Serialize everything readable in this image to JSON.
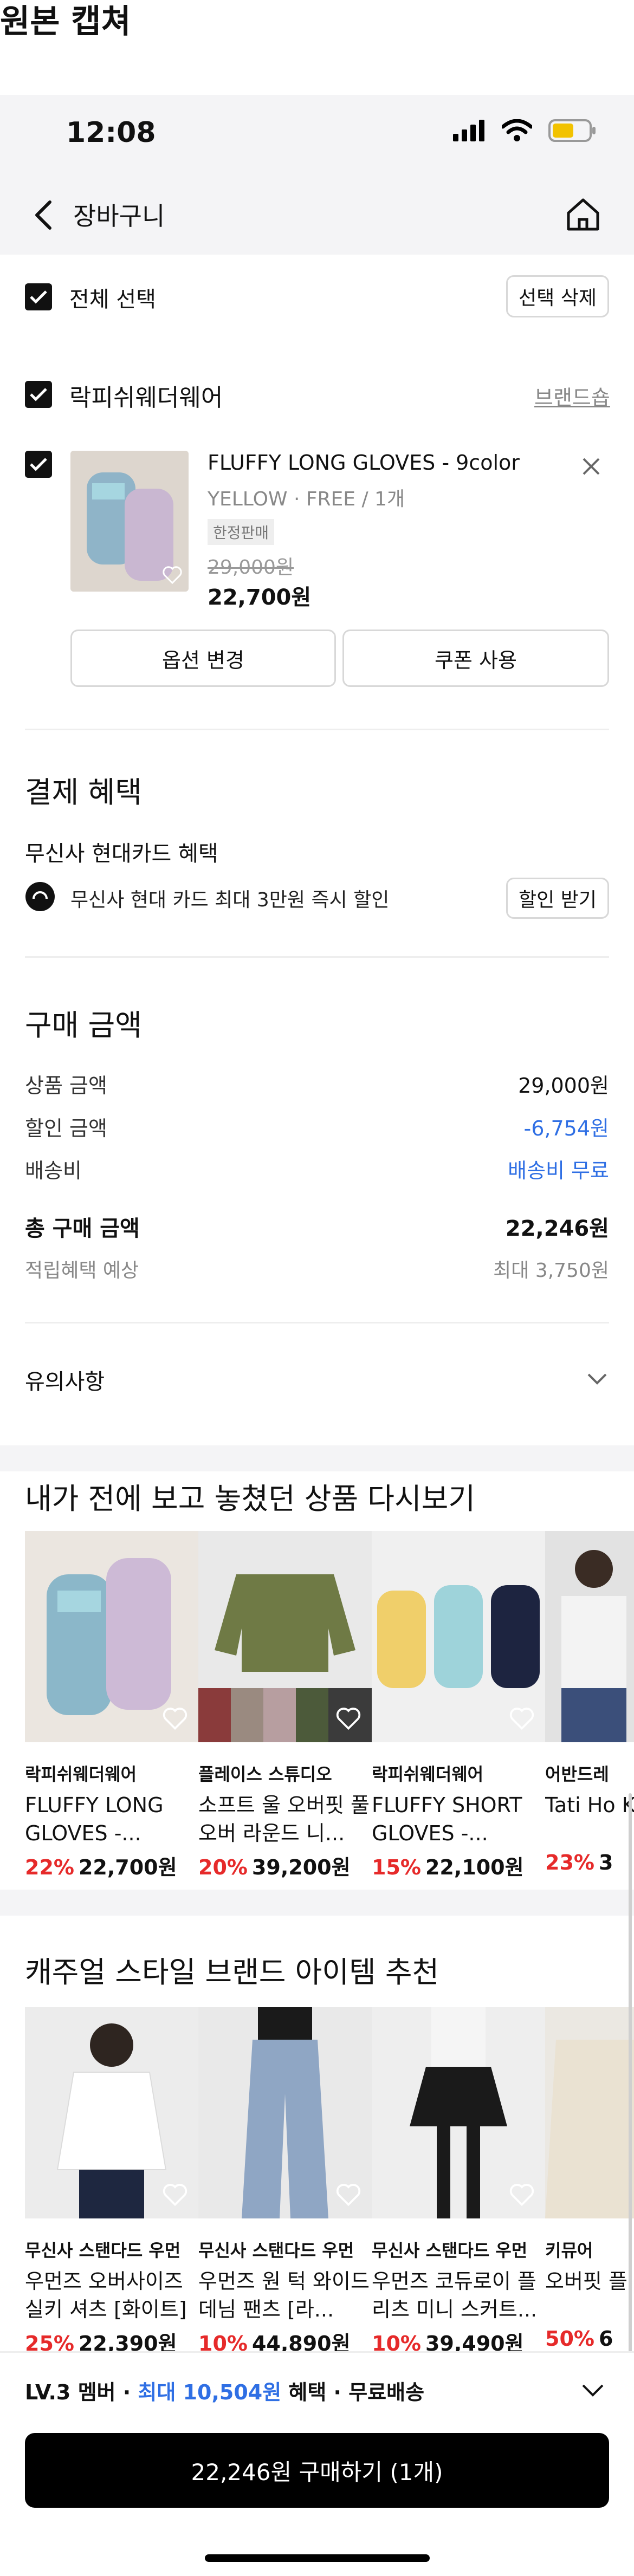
{
  "caption": "원본 캡쳐",
  "status": {
    "time": "12:08"
  },
  "nav": {
    "title": "장바구니"
  },
  "select_all": {
    "label": "전체 선택",
    "delete_button": "선택 삭제"
  },
  "brand_group": {
    "name": "락피쉬웨더웨어",
    "brand_shop_link": "브랜드숍",
    "item": {
      "name": "FLUFFY LONG GLOVES - 9color",
      "option": "YELLOW · FREE / 1개",
      "tag": "한정판매",
      "original_price": "29,000원",
      "price": "22,700원"
    },
    "change_option_button": "옵션 변경",
    "coupon_button": "쿠폰 사용"
  },
  "benefits": {
    "title": "결제 혜택",
    "card_title": "무신사 현대카드 혜택",
    "card_text": "무신사 현대 카드 최대 3만원 즉시 할인",
    "get_discount_button": "할인 받기"
  },
  "purchase": {
    "title": "구매 금액",
    "rows": [
      {
        "label": "상품 금액",
        "value": "29,000원",
        "color": "#111111"
      },
      {
        "label": "할인 금액",
        "value": "-6,754원",
        "color": "#2f6fe4"
      },
      {
        "label": "배송비",
        "value": "배송비 무료",
        "color": "#2f6fe4"
      }
    ],
    "total_label": "총 구매 금액",
    "total_value": "22,246원",
    "reward_label": "적립혜택 예상",
    "reward_value": "최대 3,750원"
  },
  "notice": {
    "label": "유의사항"
  },
  "recent": {
    "title": "내가 전에 보고 놓쳤던 상품 다시보기",
    "items": [
      {
        "brand": "락피쉬웨더웨어",
        "name": "FLUFFY LONG GLOVES -...",
        "discount": "22%",
        "price": "22,700원",
        "bg": "#e8e3dd",
        "accent": "#8bb7c9"
      },
      {
        "brand": "플레이스 스튜디오",
        "name": "소프트 울 오버핏 풀오버 라운드 니...",
        "discount": "20%",
        "price": "39,200원",
        "bg": "#e6e6e6",
        "accent": "#6f7a45"
      },
      {
        "brand": "락피쉬웨더웨어",
        "name": "FLUFFY SHORT GLOVES -...",
        "discount": "15%",
        "price": "22,100원",
        "bg": "#eeeeee",
        "accent": "#f0cf6a"
      },
      {
        "brand": "어반드레",
        "name": "Tati Ho Knit IVO",
        "discount": "23%",
        "price": "3",
        "bg": "#d9d9d9",
        "accent": "#3b4f7a"
      }
    ]
  },
  "recommend": {
    "title": "캐주얼 스타일 브랜드 아이템 추천",
    "items": [
      {
        "brand": "무신사 스탠다드 우먼",
        "name": "우먼즈 오버사이즈 실키 셔츠 [화이트]",
        "discount": "25%",
        "price": "22,390원",
        "bg": "#ececec",
        "accent": "#ffffff"
      },
      {
        "brand": "무신사 스탠다드 우먼",
        "name": "우먼즈 원 턱 와이드 데님 팬츠 [라...",
        "discount": "10%",
        "price": "44,890원",
        "bg": "#e9e9e9",
        "accent": "#8fa6c4"
      },
      {
        "brand": "무신사 스탠다드 우먼",
        "name": "우먼즈 코듀로이 플리츠 미니 스커트...",
        "discount": "10%",
        "price": "39,490원",
        "bg": "#eeeeee",
        "accent": "#1a1a1a"
      },
      {
        "brand": "키뮤어",
        "name": "오버핏 플 후드",
        "discount": "50%",
        "price": "6",
        "bg": "#e6e3de",
        "accent": "#eae2d2"
      }
    ]
  },
  "bottom": {
    "member_prefix": "LV.3 멤버 · ",
    "member_highlight": "최대 10,504원",
    "member_suffix": " 혜택 · 무료배송",
    "buy_button": "22,246원 구매하기 (1개)"
  }
}
